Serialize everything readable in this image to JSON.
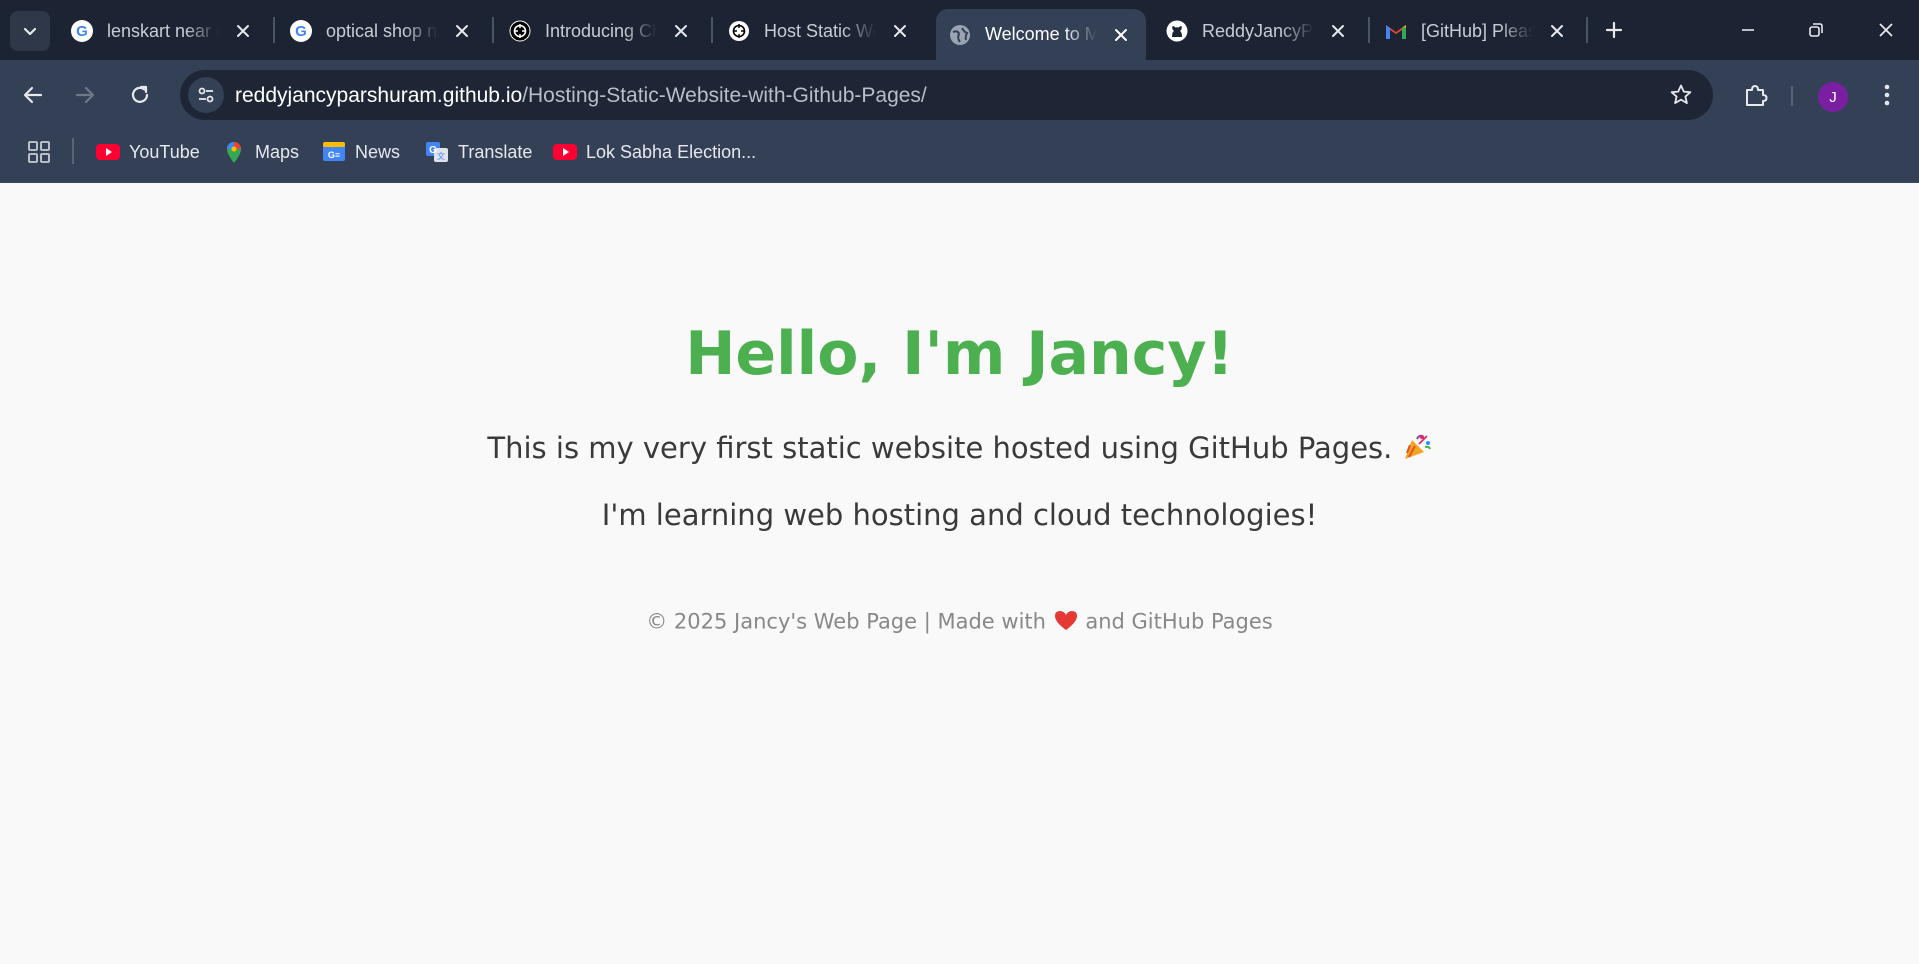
{
  "browser": {
    "tabs": [
      {
        "title": "lenskart near me - Google Search",
        "icon": "google-icon"
      },
      {
        "title": "optical shop near me - Google Search",
        "icon": "google-icon"
      },
      {
        "title": "Introducing ChatGPT",
        "icon": "openai-icon"
      },
      {
        "title": "Host Static Website",
        "icon": "openai-icon"
      },
      {
        "title": "Welcome to My Website",
        "icon": "globe-icon",
        "active": true
      },
      {
        "title": "ReddyJancyParshuram",
        "icon": "github-icon"
      },
      {
        "title": "[GitHub] Please verify",
        "icon": "gmail-icon"
      }
    ],
    "address_bar": {
      "domain": "reddyjancyparshuram.github.io",
      "path": "/Hosting-Static-Website-with-Github-Pages/"
    },
    "profile_initial": "J",
    "bookmarks": [
      {
        "label": "YouTube",
        "icon": "youtube-icon"
      },
      {
        "label": "Maps",
        "icon": "maps-icon"
      },
      {
        "label": "News",
        "icon": "news-icon"
      },
      {
        "label": "Translate",
        "icon": "translate-icon"
      },
      {
        "label": "Lok Sabha Election...",
        "icon": "youtube-icon"
      }
    ]
  },
  "page": {
    "heading": "Hello, I'm Jancy!",
    "intro": "This is my very first static website hosted using GitHub Pages.",
    "learning": "I'm learning web hosting and cloud technologies!",
    "footer_left": "© 2025 Jancy's Web Page | Made with",
    "footer_right": "and GitHub Pages"
  },
  "colors": {
    "heading": "#4caf50",
    "tabstrip": "#1c2433",
    "toolbar": "#334056",
    "avatar": "#7b1fa2"
  }
}
